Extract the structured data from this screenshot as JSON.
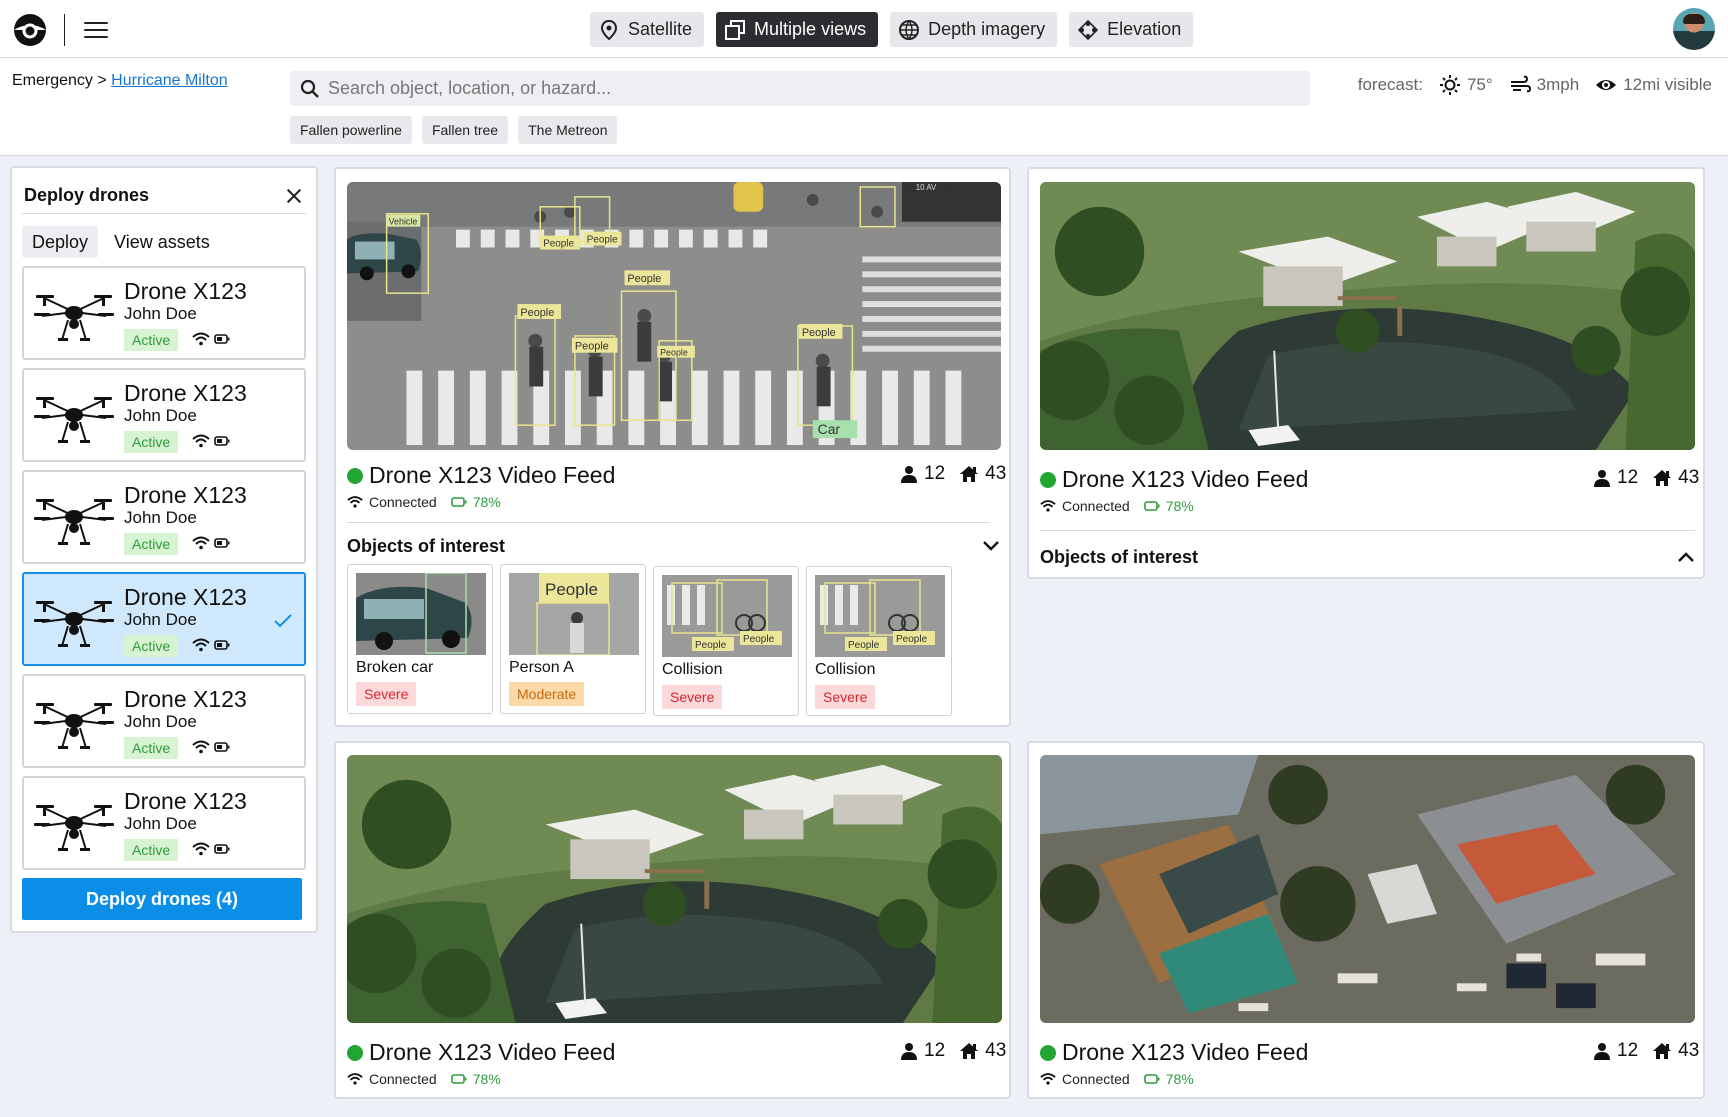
{
  "topbar": {
    "modes": [
      {
        "label": "Satellite",
        "icon": "location-pin-icon",
        "active": false
      },
      {
        "label": "Multiple views",
        "icon": "multiple-windows-icon",
        "active": true
      },
      {
        "label": "Depth imagery",
        "icon": "globe-icon",
        "active": false
      },
      {
        "label": "Elevation",
        "icon": "elevation-diamond-icon",
        "active": false
      }
    ]
  },
  "breadcrumb": {
    "root": "Emergency",
    "separator": ">",
    "current": "Hurricane Milton"
  },
  "search": {
    "placeholder": "Search object, location, or hazard..."
  },
  "chips": [
    "Fallen powerline",
    "Fallen tree",
    "The Metreon"
  ],
  "forecast": {
    "label": "forecast:",
    "temperature": "75°",
    "wind": "3mph",
    "visibility": "12mi visible"
  },
  "sidebar": {
    "title": "Deploy drones",
    "tabs": [
      "Deploy",
      "View assets"
    ],
    "drones": [
      {
        "name": "Drone X123",
        "user": "John Doe",
        "status": "Active",
        "selected": false
      },
      {
        "name": "Drone X123",
        "user": "John Doe",
        "status": "Active",
        "selected": false
      },
      {
        "name": "Drone X123",
        "user": "John Doe",
        "status": "Active",
        "selected": false
      },
      {
        "name": "Drone X123",
        "user": "John Doe",
        "status": "Active",
        "selected": true
      },
      {
        "name": "Drone X123",
        "user": "John Doe",
        "status": "Active",
        "selected": false
      },
      {
        "name": "Drone X123",
        "user": "John Doe",
        "status": "Active",
        "selected": false
      }
    ],
    "deploy_button": "Deploy drones (4)"
  },
  "feeds": [
    {
      "title": "Drone X123 Video Feed",
      "people": "12",
      "homes": "43",
      "connection": "Connected",
      "battery": "78%",
      "ooi_title": "Objects of interest",
      "expanded": true,
      "objects": [
        {
          "label": "Broken car",
          "severity": "Severe"
        },
        {
          "label": "Person A",
          "severity": "Moderate"
        },
        {
          "label": "Collision",
          "severity": "Severe"
        },
        {
          "label": "Collision",
          "severity": "Severe"
        }
      ]
    },
    {
      "title": "Drone X123 Video Feed",
      "people": "12",
      "homes": "43",
      "connection": "Connected",
      "battery": "78%",
      "ooi_title": "Objects of interest",
      "expanded": false
    },
    {
      "title": "Drone X123 Video Feed",
      "people": "12",
      "homes": "43",
      "connection": "Connected",
      "battery": "78%"
    },
    {
      "title": "Drone X123 Video Feed",
      "people": "12",
      "homes": "43",
      "connection": "Connected",
      "battery": "78%"
    }
  ],
  "detections": {
    "vehicle": "Vehicle",
    "people": "People",
    "car": "Car",
    "street_sign": "10 AV"
  },
  "colors": {
    "accent": "#0a8ee8",
    "active_green": "#22a535",
    "severe": "#d7262f",
    "moderate": "#c56a10",
    "selected_bg": "#cfe8fb"
  }
}
